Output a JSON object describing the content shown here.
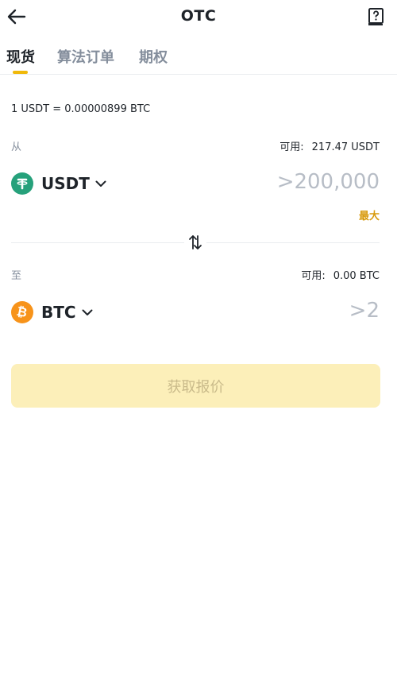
{
  "header": {
    "title": "OTC",
    "back_icon": "arrow-left-icon",
    "help_icon": "help-book-icon"
  },
  "tabs": [
    {
      "label": "现货",
      "active": true
    },
    {
      "label": "算法订单",
      "active": false
    },
    {
      "label": "期权",
      "active": false
    }
  ],
  "rate": "1 USDT = 0.00000899 BTC",
  "from": {
    "label": "从",
    "available_label": "可用:",
    "available_value": "217.47 USDT",
    "coin": "USDT",
    "amount_placeholder": ">200,000",
    "max_label": "最大"
  },
  "to": {
    "label": "至",
    "available_label": "可用:",
    "available_value": "0.00 BTC",
    "coin": "BTC",
    "amount_placeholder": ">2"
  },
  "action": {
    "quote_label": "获取报价"
  },
  "colors": {
    "accent": "#f0b90b",
    "usdt": "#26a17b",
    "btc": "#f7931a",
    "button_bg": "#fcefb9"
  }
}
